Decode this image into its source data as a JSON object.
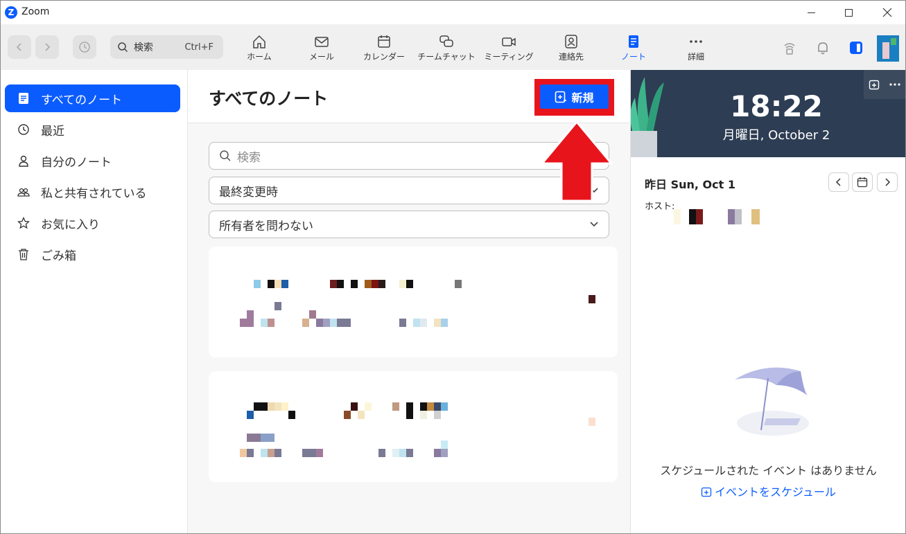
{
  "window": {
    "title": "Zoom",
    "logo_letter": "Z"
  },
  "toolbar": {
    "search_label": "検索",
    "search_shortcut": "Ctrl+F",
    "tabs": [
      {
        "label": "ホーム",
        "icon": "home-icon"
      },
      {
        "label": "メール",
        "icon": "mail-icon"
      },
      {
        "label": "カレンダー",
        "icon": "calendar-icon"
      },
      {
        "label": "チームチャット",
        "icon": "chat-icon"
      },
      {
        "label": "ミーティング",
        "icon": "video-icon"
      },
      {
        "label": "連絡先",
        "icon": "contacts-icon"
      },
      {
        "label": "ノート",
        "icon": "notes-icon",
        "active": true
      },
      {
        "label": "詳細",
        "icon": "more-icon"
      }
    ]
  },
  "sidebar": {
    "items": [
      {
        "label": "すべてのノート",
        "icon": "notes-icon",
        "active": true
      },
      {
        "label": "最近",
        "icon": "clock-icon"
      },
      {
        "label": "自分のノート",
        "icon": "person-icon"
      },
      {
        "label": "私と共有されている",
        "icon": "people-icon"
      },
      {
        "label": "お気に入り",
        "icon": "star-icon"
      },
      {
        "label": "ごみ箱",
        "icon": "trash-icon"
      }
    ]
  },
  "main": {
    "title": "すべてのノート",
    "new_button_label": "新規",
    "search_placeholder": "検索",
    "sort_value": "最終変更時",
    "owner_filter_value": "所有者を問わない"
  },
  "calendar_panel": {
    "time": "18:22",
    "date": "月曜日, October 2",
    "day_label": "昨日 Sun, Oct 1",
    "host_label": "ホスト:",
    "empty_text": "スケジュールされた イベント はありません",
    "schedule_link": "イベントをスケジュール"
  },
  "colors": {
    "accent": "#0b5cff",
    "highlight_red": "#e8141c",
    "banner": "#2d3d53"
  }
}
